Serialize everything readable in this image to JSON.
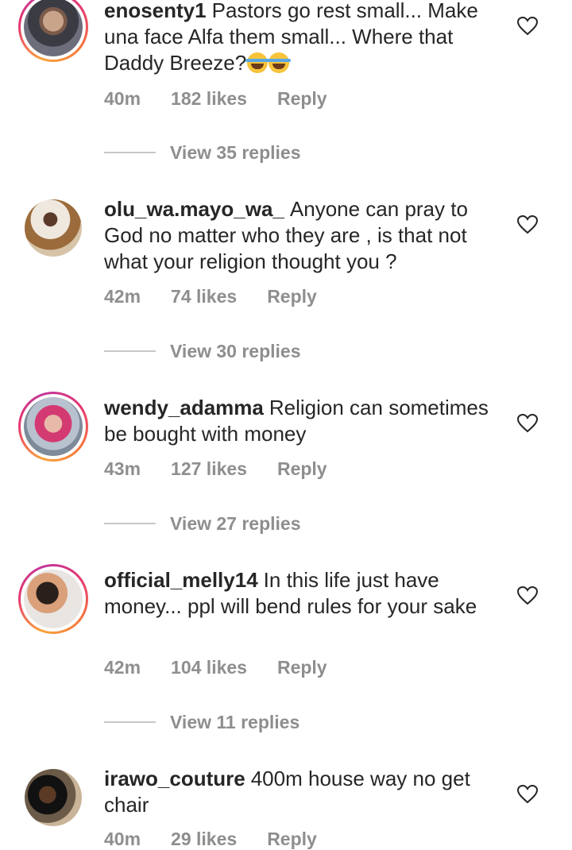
{
  "comments": [
    {
      "username": "enosenty1",
      "text": "Pastors go rest small... Make una face Alfa them small... Where that Daddy Breeze?",
      "emoji_count": 2,
      "time": "40m",
      "likes": "182 likes",
      "reply": "Reply",
      "view_replies": "View 35 replies",
      "story_ring": true
    },
    {
      "username": "olu_wa.mayo_wa_",
      "text": "Anyone can pray to God no matter who they are , is that not what your religion thought you ?",
      "time": "42m",
      "likes": "74 likes",
      "reply": "Reply",
      "view_replies": "View 30 replies",
      "story_ring": false
    },
    {
      "username": "wendy_adamma",
      "text": "Religion can sometimes be bought with money",
      "time": "43m",
      "likes": "127 likes",
      "reply": "Reply",
      "view_replies": "View 27 replies",
      "story_ring": true
    },
    {
      "username": "official_melly14",
      "text": "In this life just have money... ppl will bend rules for your sake",
      "time": "42m",
      "likes": "104 likes",
      "reply": "Reply",
      "view_replies": "View 11 replies",
      "story_ring": true
    },
    {
      "username": "irawo_couture",
      "text": "400m house way no get chair",
      "time": "40m",
      "likes": "29 likes",
      "reply": "Reply",
      "story_ring": false
    }
  ],
  "icons": {
    "like": "heart-outline-icon",
    "emoji": "face-with-tears-of-joy"
  },
  "colors": {
    "text": "#262626",
    "secondary": "#8e8e8e",
    "story_ring_start": "#f9a23a",
    "story_ring_end": "#c1359a"
  }
}
